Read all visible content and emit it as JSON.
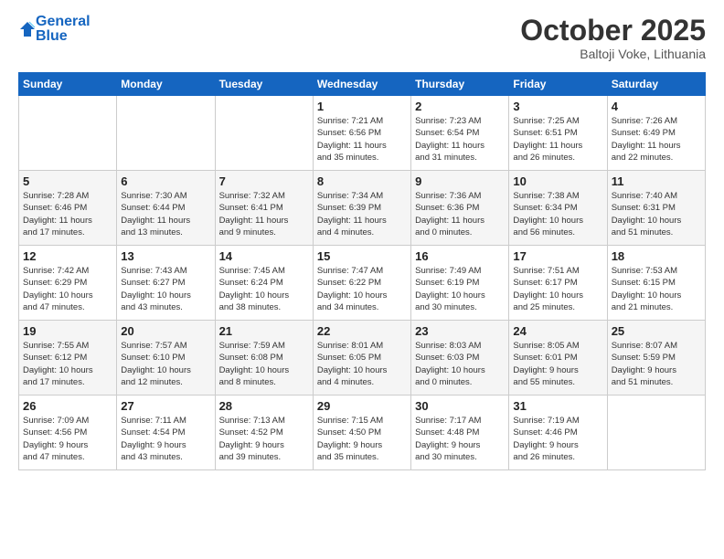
{
  "logo": {
    "line1": "General",
    "line2": "Blue"
  },
  "header": {
    "month": "October 2025",
    "location": "Baltoji Voke, Lithuania"
  },
  "days_of_week": [
    "Sunday",
    "Monday",
    "Tuesday",
    "Wednesday",
    "Thursday",
    "Friday",
    "Saturday"
  ],
  "weeks": [
    [
      {
        "day": "",
        "info": ""
      },
      {
        "day": "",
        "info": ""
      },
      {
        "day": "",
        "info": ""
      },
      {
        "day": "1",
        "info": "Sunrise: 7:21 AM\nSunset: 6:56 PM\nDaylight: 11 hours\nand 35 minutes."
      },
      {
        "day": "2",
        "info": "Sunrise: 7:23 AM\nSunset: 6:54 PM\nDaylight: 11 hours\nand 31 minutes."
      },
      {
        "day": "3",
        "info": "Sunrise: 7:25 AM\nSunset: 6:51 PM\nDaylight: 11 hours\nand 26 minutes."
      },
      {
        "day": "4",
        "info": "Sunrise: 7:26 AM\nSunset: 6:49 PM\nDaylight: 11 hours\nand 22 minutes."
      }
    ],
    [
      {
        "day": "5",
        "info": "Sunrise: 7:28 AM\nSunset: 6:46 PM\nDaylight: 11 hours\nand 17 minutes."
      },
      {
        "day": "6",
        "info": "Sunrise: 7:30 AM\nSunset: 6:44 PM\nDaylight: 11 hours\nand 13 minutes."
      },
      {
        "day": "7",
        "info": "Sunrise: 7:32 AM\nSunset: 6:41 PM\nDaylight: 11 hours\nand 9 minutes."
      },
      {
        "day": "8",
        "info": "Sunrise: 7:34 AM\nSunset: 6:39 PM\nDaylight: 11 hours\nand 4 minutes."
      },
      {
        "day": "9",
        "info": "Sunrise: 7:36 AM\nSunset: 6:36 PM\nDaylight: 11 hours\nand 0 minutes."
      },
      {
        "day": "10",
        "info": "Sunrise: 7:38 AM\nSunset: 6:34 PM\nDaylight: 10 hours\nand 56 minutes."
      },
      {
        "day": "11",
        "info": "Sunrise: 7:40 AM\nSunset: 6:31 PM\nDaylight: 10 hours\nand 51 minutes."
      }
    ],
    [
      {
        "day": "12",
        "info": "Sunrise: 7:42 AM\nSunset: 6:29 PM\nDaylight: 10 hours\nand 47 minutes."
      },
      {
        "day": "13",
        "info": "Sunrise: 7:43 AM\nSunset: 6:27 PM\nDaylight: 10 hours\nand 43 minutes."
      },
      {
        "day": "14",
        "info": "Sunrise: 7:45 AM\nSunset: 6:24 PM\nDaylight: 10 hours\nand 38 minutes."
      },
      {
        "day": "15",
        "info": "Sunrise: 7:47 AM\nSunset: 6:22 PM\nDaylight: 10 hours\nand 34 minutes."
      },
      {
        "day": "16",
        "info": "Sunrise: 7:49 AM\nSunset: 6:19 PM\nDaylight: 10 hours\nand 30 minutes."
      },
      {
        "day": "17",
        "info": "Sunrise: 7:51 AM\nSunset: 6:17 PM\nDaylight: 10 hours\nand 25 minutes."
      },
      {
        "day": "18",
        "info": "Sunrise: 7:53 AM\nSunset: 6:15 PM\nDaylight: 10 hours\nand 21 minutes."
      }
    ],
    [
      {
        "day": "19",
        "info": "Sunrise: 7:55 AM\nSunset: 6:12 PM\nDaylight: 10 hours\nand 17 minutes."
      },
      {
        "day": "20",
        "info": "Sunrise: 7:57 AM\nSunset: 6:10 PM\nDaylight: 10 hours\nand 12 minutes."
      },
      {
        "day": "21",
        "info": "Sunrise: 7:59 AM\nSunset: 6:08 PM\nDaylight: 10 hours\nand 8 minutes."
      },
      {
        "day": "22",
        "info": "Sunrise: 8:01 AM\nSunset: 6:05 PM\nDaylight: 10 hours\nand 4 minutes."
      },
      {
        "day": "23",
        "info": "Sunrise: 8:03 AM\nSunset: 6:03 PM\nDaylight: 10 hours\nand 0 minutes."
      },
      {
        "day": "24",
        "info": "Sunrise: 8:05 AM\nSunset: 6:01 PM\nDaylight: 9 hours\nand 55 minutes."
      },
      {
        "day": "25",
        "info": "Sunrise: 8:07 AM\nSunset: 5:59 PM\nDaylight: 9 hours\nand 51 minutes."
      }
    ],
    [
      {
        "day": "26",
        "info": "Sunrise: 7:09 AM\nSunset: 4:56 PM\nDaylight: 9 hours\nand 47 minutes."
      },
      {
        "day": "27",
        "info": "Sunrise: 7:11 AM\nSunset: 4:54 PM\nDaylight: 9 hours\nand 43 minutes."
      },
      {
        "day": "28",
        "info": "Sunrise: 7:13 AM\nSunset: 4:52 PM\nDaylight: 9 hours\nand 39 minutes."
      },
      {
        "day": "29",
        "info": "Sunrise: 7:15 AM\nSunset: 4:50 PM\nDaylight: 9 hours\nand 35 minutes."
      },
      {
        "day": "30",
        "info": "Sunrise: 7:17 AM\nSunset: 4:48 PM\nDaylight: 9 hours\nand 30 minutes."
      },
      {
        "day": "31",
        "info": "Sunrise: 7:19 AM\nSunset: 4:46 PM\nDaylight: 9 hours\nand 26 minutes."
      },
      {
        "day": "",
        "info": ""
      }
    ]
  ]
}
